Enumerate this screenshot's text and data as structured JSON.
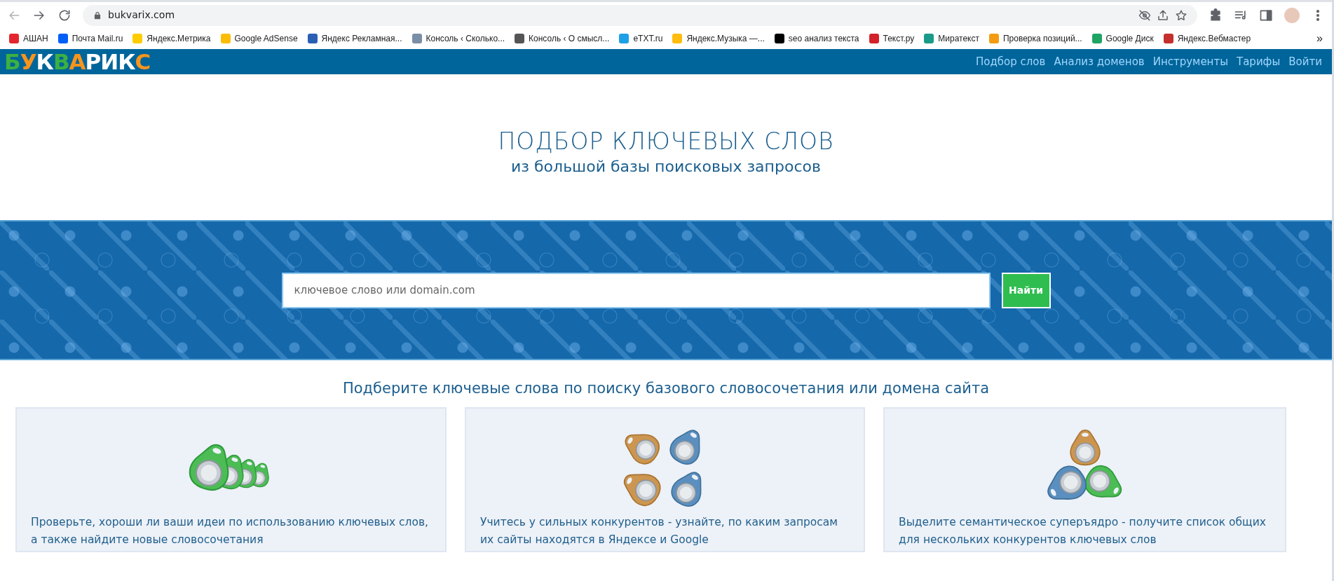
{
  "browser": {
    "url": "bukvarix.com",
    "bookmarks": [
      {
        "label": "АШАН",
        "color": "#e3262e"
      },
      {
        "label": "Почта Mail.ru",
        "color": "#005ff9"
      },
      {
        "label": "Яндекс.Метрика",
        "color": "#ffcc00"
      },
      {
        "label": "Google AdSense",
        "color": "#fbbc04"
      },
      {
        "label": "Яндекс Рекламная...",
        "color": "#2b5fb4"
      },
      {
        "label": "Консоль ‹ Сколько...",
        "color": "#7a8fa6"
      },
      {
        "label": "Консоль ‹ О смысл...",
        "color": "#555555"
      },
      {
        "label": "eTXT.ru",
        "color": "#1ea0e6"
      },
      {
        "label": "Яндекс.Музыка —...",
        "color": "#ffbc0d"
      },
      {
        "label": "seo анализ текста",
        "color": "#000000"
      },
      {
        "label": "Текст.ру",
        "color": "#d2232a"
      },
      {
        "label": "Миратекст",
        "color": "#1a9b8a"
      },
      {
        "label": "Проверка позиций...",
        "color": "#f39c12"
      },
      {
        "label": "Google Диск",
        "color": "#1fa463"
      },
      {
        "label": "Яндекс.Вебмастер",
        "color": "#c4302b"
      }
    ],
    "more": "»"
  },
  "site": {
    "logo": [
      {
        "char": "Б",
        "color": "#3cb043"
      },
      {
        "char": "У",
        "color": "#f7941d"
      },
      {
        "char": "К",
        "color": "#ffffff"
      },
      {
        "char": "В",
        "color": "#3cb043"
      },
      {
        "char": "А",
        "color": "#f7941d"
      },
      {
        "char": "Р",
        "color": "#ffffff"
      },
      {
        "char": "И",
        "color": "#ffffff"
      },
      {
        "char": "К",
        "color": "#ffffff"
      },
      {
        "char": "С",
        "color": "#f7941d"
      }
    ],
    "nav": [
      "Подбор слов",
      "Анализ доменов",
      "Инструменты",
      "Тарифы",
      "Войти"
    ]
  },
  "hero": {
    "title": "ПОДБОР КЛЮЧЕВЫХ СЛОВ",
    "subtitle": "из большой базы поисковых запросов"
  },
  "search": {
    "placeholder": "ключевое слово или domain.com",
    "button": "Найти"
  },
  "features_heading": "Подберите ключевые слова по поиску базового словосочетания или домена сайта",
  "features": [
    {
      "kind": "chain",
      "text": "Проверьте, хороши ли ваши идеи по использованию ключевых слов, а также найдите новые словосочетания"
    },
    {
      "kind": "grid",
      "text": "Учитесь у сильных конкурентов - узнайте, по каким запросам их сайты находятся в Яндексе и Google"
    },
    {
      "kind": "triad",
      "text": "Выделите семантическое суперъядро - получите список общих для нескольких конкурентов ключевых слов"
    }
  ]
}
